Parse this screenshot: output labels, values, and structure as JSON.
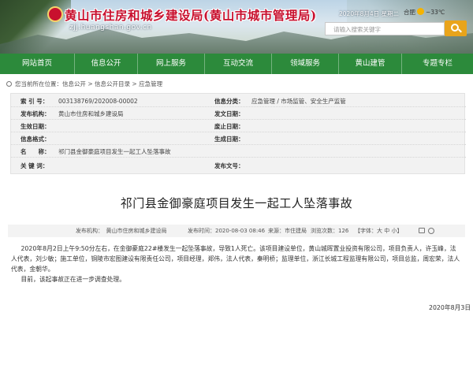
{
  "header": {
    "site_title": "黄山市住房和城乡建设局(黄山市城市管理局)",
    "site_url": "zjj.huangshan.gov.cn",
    "date": "2020年8月4日 星期二",
    "weather_city": "合肥",
    "weather_temp": "~33℃",
    "search_placeholder": "请输入搜索关键字"
  },
  "nav": {
    "items": [
      "网站首页",
      "信息公开",
      "网上服务",
      "互动交流",
      "领域服务",
      "黄山建管",
      "专题专栏"
    ]
  },
  "breadcrumb": {
    "prefix": "您当前所在位置：",
    "path": "信息公开 > 信息公开目录 > 应急管理"
  },
  "info": {
    "index_label": "索 引 号：",
    "index_value": "003138769/202008-00002",
    "category_label": "信息分类：",
    "category_value": "应急管理 / 市场监管、安全生产监管",
    "publisher_label": "发布机构：",
    "publisher_value": "黄山市住房和城乡建设局",
    "doc_no_label": "发文日期：",
    "effective_label": "生效日期：",
    "repeal_label": "废止日期：",
    "format_label": "信息格式：",
    "gen_date_label": "生成日期：",
    "name_label": "名　　称：",
    "name_value": "祁门县金御豪庭项目发生一起工人坠落事故",
    "keyword_label": "关 键 词：",
    "docnum_label": "发布文号："
  },
  "article": {
    "title": "祁门县金御豪庭项目发生一起工人坠落事故",
    "meta_publisher": "发布机构：　黄山市住房和城乡建设局",
    "meta_time": "发布时间：2020-08-03 08:46",
    "meta_source": "来源：市住建局",
    "meta_views": "浏览次数：126",
    "font_label": "【字体：",
    "font_big": "大",
    "font_mid": "中",
    "font_small": "小",
    "font_end": "】",
    "paragraph1": "2020年8月2日上午9:50分左右，在金御豪庭22#楼发生一起坠落事故，导致1人死亡。该项目建设单位，黄山城晖置业投资有限公司，项目负责人，许玉峰，法人代表，刘少敏；施工单位，铜陵市宏图建设有限责任公司，项目经理，郑伟，法人代表，秦明桥；监理单位，浙江长城工程监理有限公司，项目总监，周宏荣，法人代表，金朝华。",
    "paragraph2": "目前，该起事故正在进一步调查处理。",
    "date": "2020年8月3日"
  }
}
